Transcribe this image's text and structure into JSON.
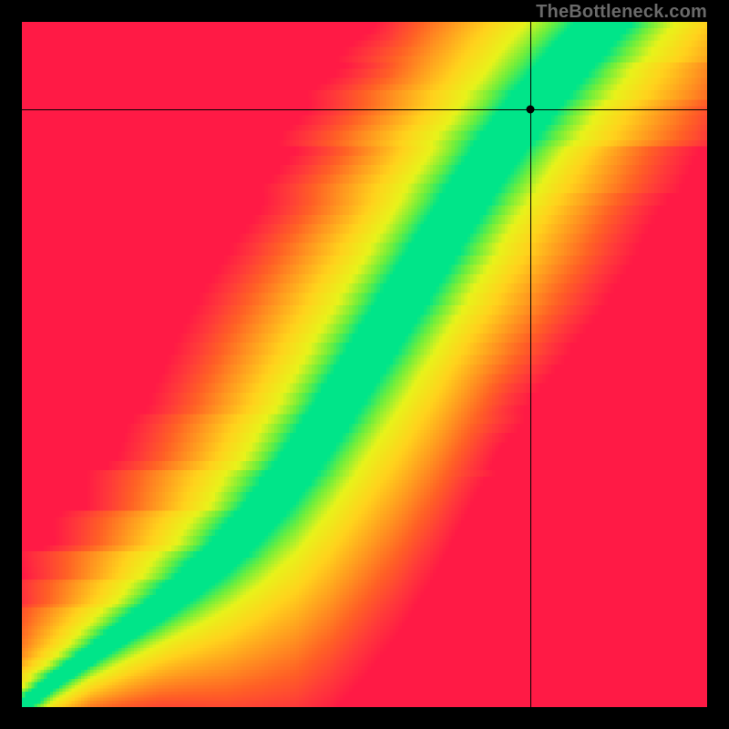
{
  "watermark": "TheBottleneck.com",
  "chart_data": {
    "type": "heatmap",
    "title": "",
    "xlabel": "",
    "ylabel": "",
    "xlim": [
      0,
      1
    ],
    "ylim": [
      0,
      1
    ],
    "grid": false,
    "legend": false,
    "crosshair": {
      "x": 0.742,
      "y": 0.872
    },
    "marker": {
      "x": 0.742,
      "y": 0.872
    },
    "ridge": {
      "description": "Green optimal band center as y(x); band width in y units",
      "points": [
        {
          "x": 0.0,
          "y": 0.0,
          "width": 0.01
        },
        {
          "x": 0.05,
          "y": 0.04,
          "width": 0.012
        },
        {
          "x": 0.1,
          "y": 0.075,
          "width": 0.014
        },
        {
          "x": 0.15,
          "y": 0.11,
          "width": 0.018
        },
        {
          "x": 0.2,
          "y": 0.145,
          "width": 0.022
        },
        {
          "x": 0.25,
          "y": 0.185,
          "width": 0.028
        },
        {
          "x": 0.3,
          "y": 0.23,
          "width": 0.035
        },
        {
          "x": 0.35,
          "y": 0.285,
          "width": 0.042
        },
        {
          "x": 0.4,
          "y": 0.35,
          "width": 0.05
        },
        {
          "x": 0.45,
          "y": 0.425,
          "width": 0.055
        },
        {
          "x": 0.5,
          "y": 0.505,
          "width": 0.058
        },
        {
          "x": 0.55,
          "y": 0.585,
          "width": 0.06
        },
        {
          "x": 0.6,
          "y": 0.665,
          "width": 0.06
        },
        {
          "x": 0.65,
          "y": 0.745,
          "width": 0.058
        },
        {
          "x": 0.7,
          "y": 0.82,
          "width": 0.055
        },
        {
          "x": 0.75,
          "y": 0.885,
          "width": 0.052
        },
        {
          "x": 0.8,
          "y": 0.945,
          "width": 0.048
        },
        {
          "x": 0.85,
          "y": 1.0,
          "width": 0.045
        }
      ]
    },
    "color_stops": [
      {
        "t": 0.0,
        "hex": "#00e589"
      },
      {
        "t": 0.1,
        "hex": "#6eee3c"
      },
      {
        "t": 0.22,
        "hex": "#e8f21a"
      },
      {
        "t": 0.38,
        "hex": "#ffd21c"
      },
      {
        "t": 0.55,
        "hex": "#ff9a1f"
      },
      {
        "t": 0.72,
        "hex": "#ff6025"
      },
      {
        "t": 0.86,
        "hex": "#ff3a39"
      },
      {
        "t": 1.0,
        "hex": "#ff1a45"
      }
    ],
    "resolution": 220
  }
}
